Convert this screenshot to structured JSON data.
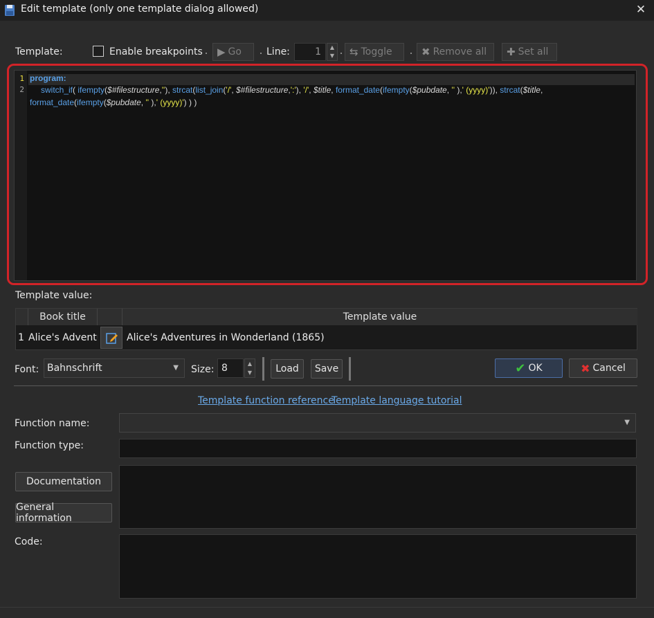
{
  "window": {
    "title": "Edit template (only one template dialog allowed)",
    "icon": "save-disk-icon"
  },
  "toolbar": {
    "template_label": "Template:",
    "enable_breakpoints_label": "Enable breakpoints",
    "go_label": "Go",
    "line_label": "Line:",
    "line_value": "1",
    "toggle_label": "Toggle",
    "remove_all_label": "Remove all",
    "set_all_label": "Set all"
  },
  "editor": {
    "line_numbers": [
      "1",
      "2"
    ],
    "line1": "program:",
    "line2_tokens": [
      {
        "t": "switch_if",
        "c": "fn"
      },
      {
        "t": "( ",
        "c": "pl"
      },
      {
        "t": "ifempty",
        "c": "fn"
      },
      {
        "t": "(",
        "c": "pl"
      },
      {
        "t": "$#filestructure",
        "c": "var"
      },
      {
        "t": ",",
        "c": "pl"
      },
      {
        "t": "''",
        "c": "str"
      },
      {
        "t": "), ",
        "c": "pl"
      },
      {
        "t": "strcat",
        "c": "fn"
      },
      {
        "t": "(",
        "c": "pl"
      },
      {
        "t": "list_join",
        "c": "fn"
      },
      {
        "t": "(",
        "c": "pl"
      },
      {
        "t": "'/'",
        "c": "str"
      },
      {
        "t": ", ",
        "c": "pl"
      },
      {
        "t": "$#filestructure",
        "c": "var"
      },
      {
        "t": ",",
        "c": "pl"
      },
      {
        "t": "':'",
        "c": "str"
      },
      {
        "t": "), ",
        "c": "pl"
      },
      {
        "t": "'/'",
        "c": "str"
      },
      {
        "t": ", ",
        "c": "pl"
      },
      {
        "t": "$title",
        "c": "var"
      },
      {
        "t": ", ",
        "c": "pl"
      },
      {
        "t": "format_date",
        "c": "fn"
      },
      {
        "t": "(",
        "c": "pl"
      },
      {
        "t": "ifempty",
        "c": "fn"
      },
      {
        "t": "(",
        "c": "pl"
      },
      {
        "t": "$pubdate",
        "c": "var"
      },
      {
        "t": ", ",
        "c": "pl"
      },
      {
        "t": "''",
        "c": "str"
      },
      {
        "t": " ),",
        "c": "pl"
      },
      {
        "t": "' (yyyy)'",
        "c": "str"
      },
      {
        "t": ")), ",
        "c": "pl"
      },
      {
        "t": "strcat",
        "c": "fn"
      },
      {
        "t": "(",
        "c": "pl"
      },
      {
        "t": "$title",
        "c": "var"
      },
      {
        "t": ",",
        "c": "pl"
      }
    ],
    "line3_tokens": [
      {
        "t": "format_date",
        "c": "fn"
      },
      {
        "t": "(",
        "c": "pl"
      },
      {
        "t": "ifempty",
        "c": "fn"
      },
      {
        "t": "(",
        "c": "pl"
      },
      {
        "t": "$pubdate",
        "c": "var"
      },
      {
        "t": ", ",
        "c": "pl"
      },
      {
        "t": "''",
        "c": "str"
      },
      {
        "t": " ),",
        "c": "pl"
      },
      {
        "t": "' (yyyy)'",
        "c": "str"
      },
      {
        "t": ") ) )",
        "c": "pl"
      }
    ]
  },
  "template_value": {
    "label": "Template value:",
    "columns": [
      "Book title",
      "Template value"
    ],
    "rows": [
      {
        "index": "1",
        "book_title": "Alice's Adventures in Wonderland",
        "value": "Alice's Adventures in Wonderland (1865)"
      }
    ]
  },
  "font_row": {
    "font_label": "Font:",
    "font_value": "Bahnschrift",
    "size_label": "Size:",
    "size_value": "8",
    "load_label": "Load",
    "save_label": "Save",
    "ok_label": "OK",
    "cancel_label": "Cancel"
  },
  "links": {
    "reference": "Template function reference",
    "tutorial": "Template language tutorial"
  },
  "function_section": {
    "name_label": "Function name:",
    "name_value": "",
    "type_label": "Function type:",
    "type_value": "",
    "documentation_button": "Documentation",
    "general_info_button": "General information",
    "code_label": "Code:"
  },
  "colors": {
    "accent_red": "#d22328",
    "keyword_blue": "#5aa0e6",
    "string_yellow": "#e6e64a",
    "ok_green": "#3ec03e",
    "cancel_red": "#e03030",
    "link_blue": "#6aa9e8"
  }
}
